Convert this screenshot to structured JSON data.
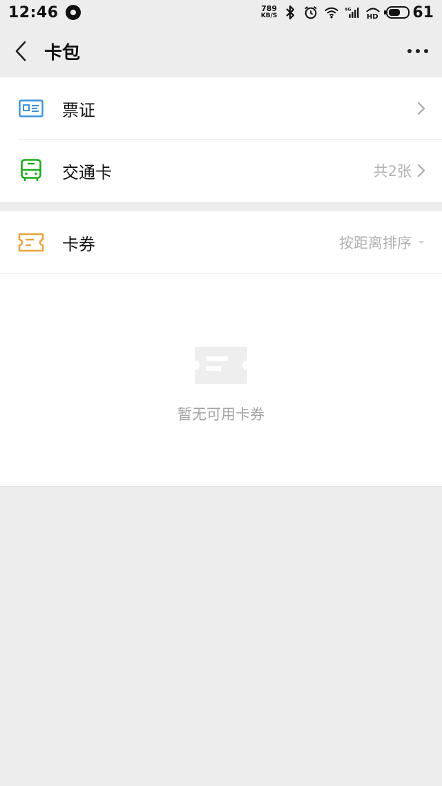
{
  "status_bar": {
    "time": "12:46",
    "speed_value": "789",
    "speed_unit": "KB/S",
    "battery_percent": "61",
    "icons": [
      "app-notification-icon",
      "bluetooth-icon",
      "alarm-icon",
      "wifi-icon",
      "signal-4g-icon",
      "hd-icon",
      "battery-icon"
    ]
  },
  "nav": {
    "title": "卡包",
    "back_icon": "chevron-left-icon",
    "more_icon": "more-dots-icon"
  },
  "section1": {
    "rows": [
      {
        "label": "票证",
        "icon": "ticket-id-icon",
        "right_text": "",
        "icon_color": "#3b93d6"
      },
      {
        "label": "交通卡",
        "icon": "bus-icon",
        "right_text": "共2张",
        "icon_color": "#1aad19"
      }
    ]
  },
  "section2": {
    "row": {
      "label": "卡券",
      "icon": "coupon-icon",
      "right_text": "按距离排序",
      "icon_color": "#e8a33d"
    },
    "empty": {
      "text": "暂无可用卡券",
      "icon": "empty-coupon-icon"
    }
  },
  "colors": {
    "background": "#ededed",
    "card": "#ffffff",
    "secondary_text": "#b2b2b2",
    "empty_text": "#a3a3a3"
  }
}
